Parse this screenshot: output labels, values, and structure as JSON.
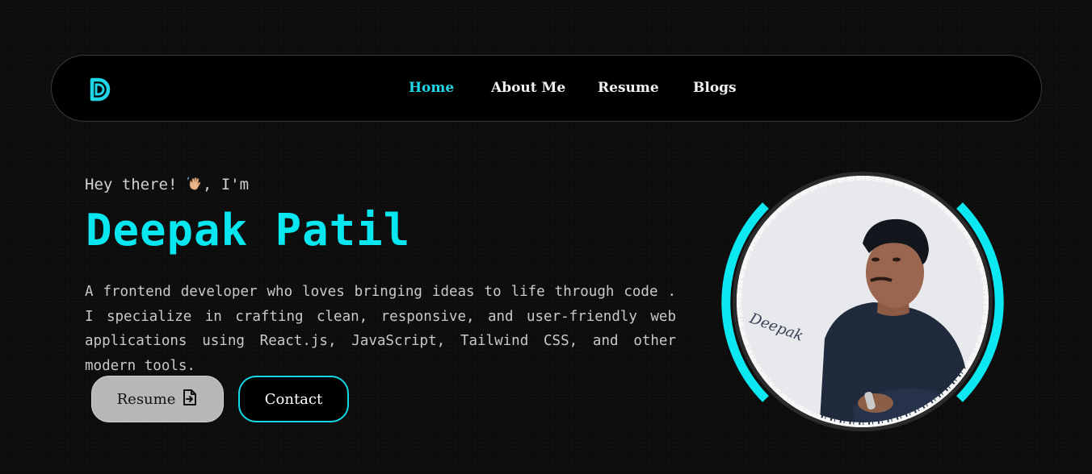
{
  "nav": {
    "logo_letter": "D",
    "logo_icon": "d-logo-icon",
    "links": [
      {
        "label": "Home",
        "active": true
      },
      {
        "label": "About Me",
        "active": false
      },
      {
        "label": "Resume",
        "active": false
      },
      {
        "label": "Blogs",
        "active": false
      }
    ]
  },
  "hero": {
    "greeting_prefix": "Hey there!",
    "greeting_icon": "waving-hand-icon",
    "greeting_suffix": ", I'm",
    "name": "Deepak Patil",
    "bio": "A frontend developer who loves bringing ideas to life through code . I specialize in crafting clean, responsive, and user-friendly web applications using React.js, JavaScript, Tailwind CSS, and other modern tools.",
    "buttons": {
      "resume_label": "Resume",
      "resume_icon": "file-export-icon",
      "contact_label": "Contact"
    },
    "portrait": {
      "signature": "Deepak"
    }
  },
  "colors": {
    "accent": "#08e6f0",
    "background": "#0b0b0b",
    "nav_background": "#000000",
    "resume_button": "#b7b7b7"
  }
}
